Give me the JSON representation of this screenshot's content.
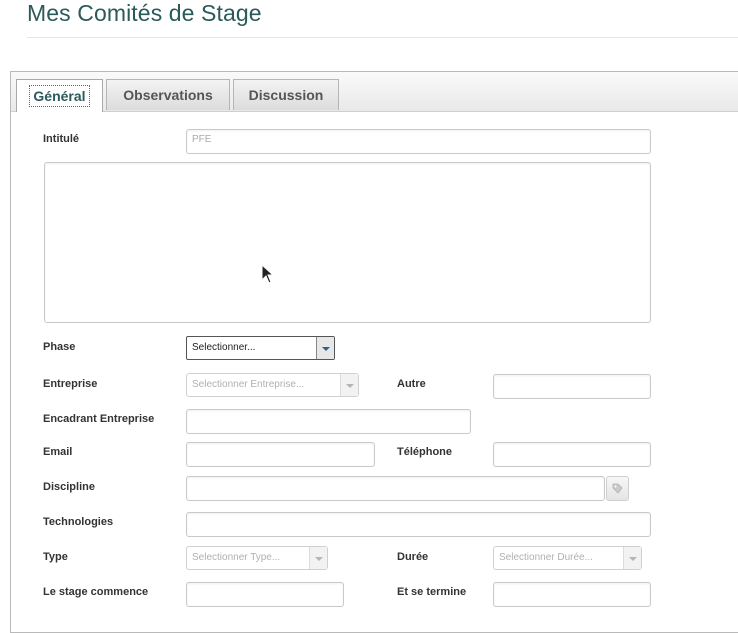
{
  "page": {
    "title": "Mes Comités de Stage"
  },
  "tabs": [
    {
      "label": "Général",
      "active": true
    },
    {
      "label": "Observations",
      "active": false
    },
    {
      "label": "Discussion",
      "active": false
    }
  ],
  "form": {
    "intitule": {
      "label": "Intitulé",
      "placeholder": "PFE"
    },
    "description": {
      "value": ""
    },
    "phase": {
      "label": "Phase",
      "value": "Selectionner..."
    },
    "entreprise": {
      "label": "Entreprise",
      "placeholder": "Selectionner Entreprise..."
    },
    "autre": {
      "label": "Autre",
      "value": ""
    },
    "encadrant": {
      "label": "Encadrant Entreprise",
      "value": ""
    },
    "email": {
      "label": "Email",
      "value": ""
    },
    "telephone": {
      "label": "Téléphone",
      "value": ""
    },
    "discipline": {
      "label": "Discipline",
      "value": ""
    },
    "technologies": {
      "label": "Technologies",
      "value": ""
    },
    "type": {
      "label": "Type",
      "placeholder": "Selectionner Type..."
    },
    "duree": {
      "label": "Durée",
      "placeholder": "Selectionner Durée..."
    },
    "debut": {
      "label": "Le stage commence",
      "value": ""
    },
    "fin": {
      "label": "Et se termine",
      "value": ""
    }
  },
  "icons": {
    "tag": "tag-icon",
    "arrow": "chevron-down-icon",
    "cursor": "mouse-cursor-icon"
  }
}
